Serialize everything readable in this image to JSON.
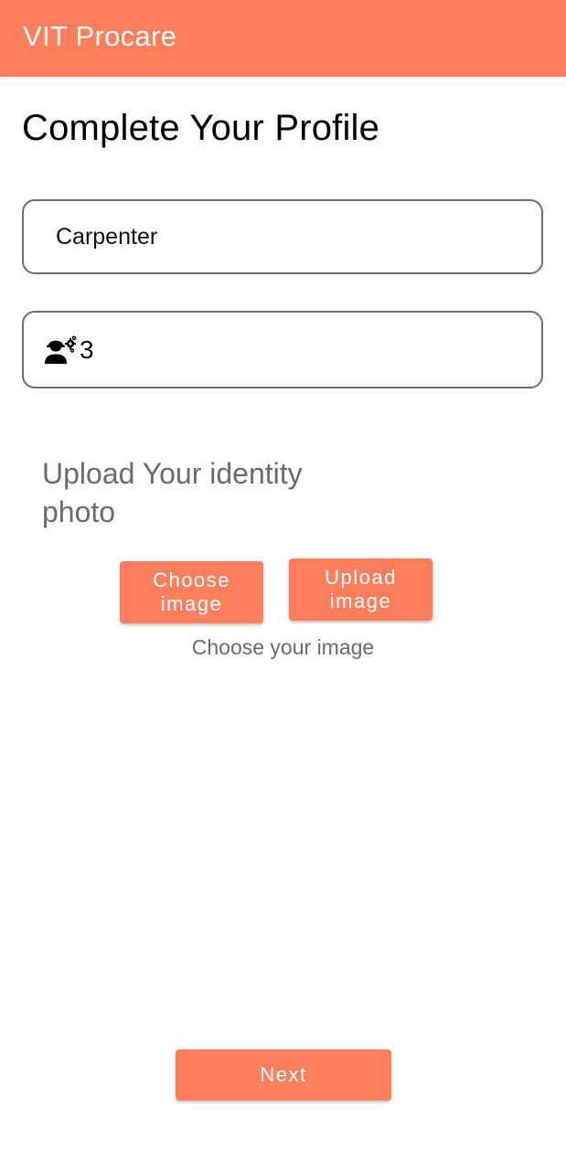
{
  "app_bar": {
    "title": "VIT Procare",
    "color": "#FF7F5C"
  },
  "page": {
    "title": "Complete Your Profile"
  },
  "form": {
    "profession_value": "Carpenter",
    "experience_icon": "worker-with-gears-icon",
    "experience_value": "3"
  },
  "upload": {
    "title": "Upload Your identity photo",
    "choose_button": "Choose image",
    "upload_button": "Upload image",
    "hint": "Choose your image"
  },
  "actions": {
    "next_button": "Next"
  }
}
